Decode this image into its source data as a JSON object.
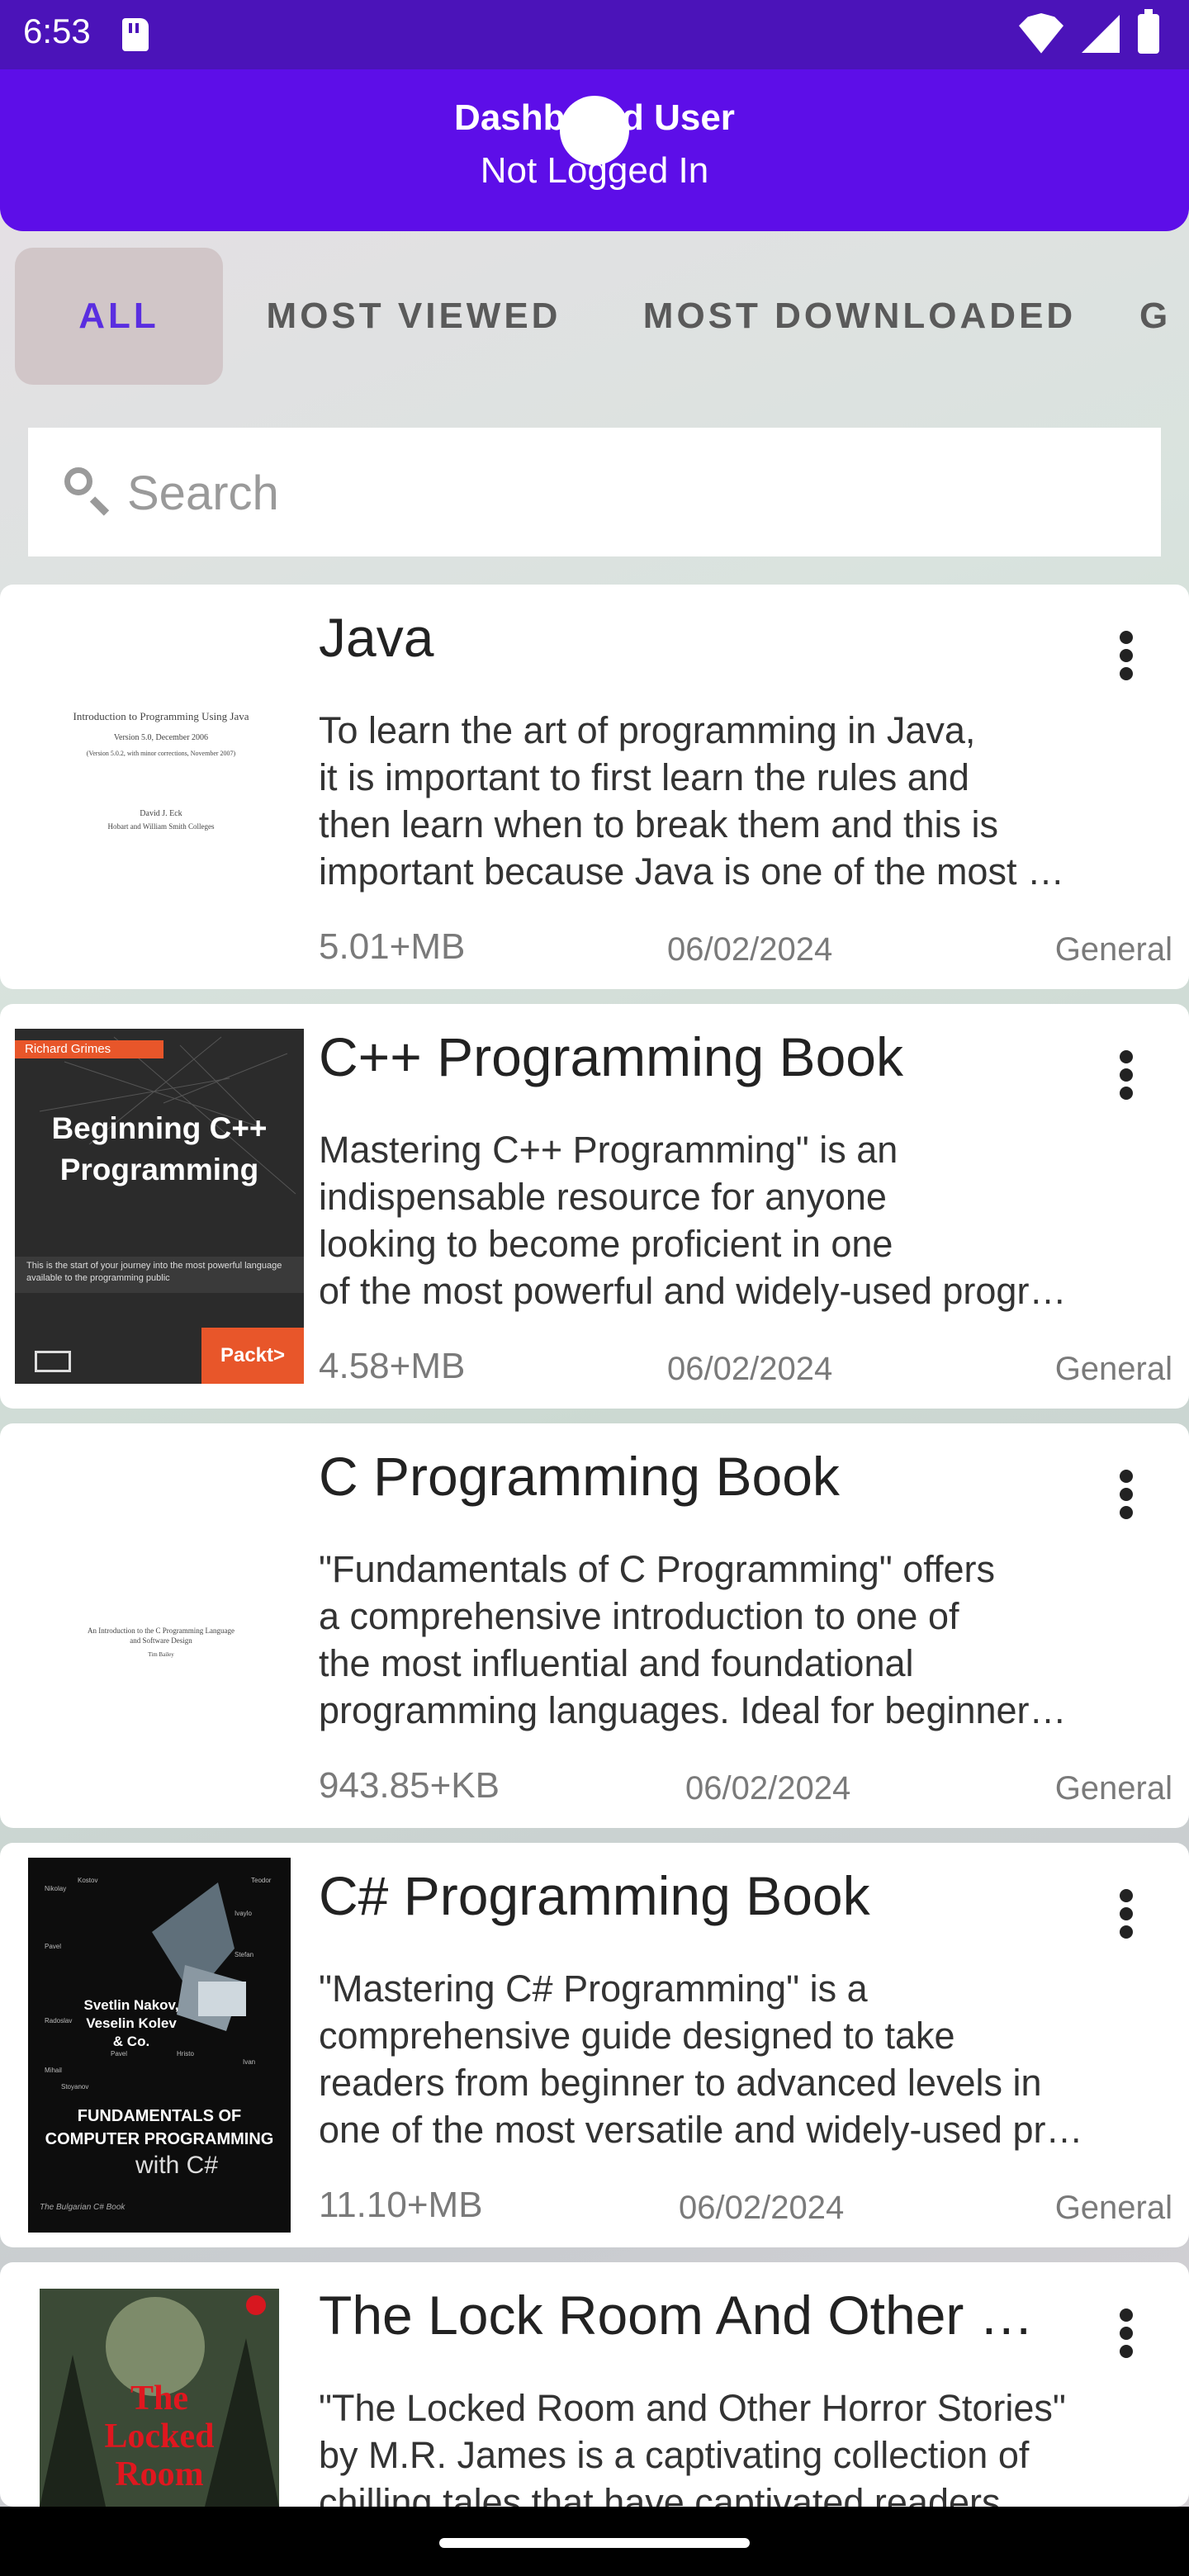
{
  "status": {
    "time": "6:53"
  },
  "header": {
    "title": "Dashboard User",
    "subtitle": "Not Logged In"
  },
  "tabs": [
    {
      "label": "ALL",
      "active": true
    },
    {
      "label": "MOST VIEWED"
    },
    {
      "label": "MOST DOWNLOADED"
    },
    {
      "label": "G"
    }
  ],
  "search": {
    "placeholder": "Search",
    "value": ""
  },
  "books": [
    {
      "title": "Java",
      "description_lines": [
        "To learn the art of programming in Java,",
        "it is important to first learn the rules and",
        "then learn when to break them and this is",
        "important because Java is one of the most …"
      ],
      "size": "5.01+MB",
      "date": "06/02/2024",
      "category": "General",
      "cover": {
        "line1": "Introduction to Programming Using Java",
        "line2": "Version 5.0, December 2006",
        "line3": "(Version 5.0.2, with minor corrections, November 2007)",
        "line4": "David J. Eck",
        "line5": "Hobart and William Smith Colleges"
      }
    },
    {
      "title": "C++ Programming Book",
      "description_lines": [
        "Mastering C++ Programming\" is an",
        "indispensable resource for anyone",
        "looking to become proficient in one",
        "of the most powerful and widely-used progr…"
      ],
      "size": "4.58+MB",
      "date": "06/02/2024",
      "category": "General",
      "cover": {
        "author": "Richard Grimes",
        "title1": "Beginning C++",
        "title2": "Programming",
        "tagline": "This is the start of your journey into the most powerful language available to the programming public",
        "publisher": "Packt>"
      }
    },
    {
      "title": "C Programming Book",
      "description_lines": [
        "\"Fundamentals of C Programming\" offers",
        "a comprehensive introduction to one of",
        "the most influential and foundational",
        "programming languages. Ideal for beginner…"
      ],
      "size": "943.85+KB",
      "date": "06/02/2024",
      "category": "General",
      "cover": {
        "line1": "An Introduction to the C Programming Language",
        "line2": "and Software Design",
        "line3": "Tim Bailey"
      }
    },
    {
      "title": "C# Programming Book",
      "description_lines": [
        "\"Mastering C# Programming\" is a",
        "comprehensive guide designed to take",
        "readers from beginner to advanced levels in",
        "one of the most versatile and widely-used pr…"
      ],
      "size": "11.10+MB",
      "date": "06/02/2024",
      "category": "General",
      "cover": {
        "authors1": "Svetlin Nakov,",
        "authors2": "Veselin Kolev",
        "authors3": "& Co.",
        "title1": "FUNDAMENTALS OF",
        "title2": "COMPUTER PROGRAMMING",
        "title3": "with C#",
        "footer": "The Bulgarian C# Book"
      }
    },
    {
      "title": "The Lock Room And Other …",
      "description_lines": [
        "\"The Locked Room and Other Horror Stories\"",
        "by M.R. James is a captivating collection of",
        "chilling tales that have captivated readers"
      ],
      "size": "",
      "date": "",
      "category": "",
      "cover": {
        "title1": "The",
        "title2": "Locked",
        "title3": "Room"
      }
    }
  ]
}
